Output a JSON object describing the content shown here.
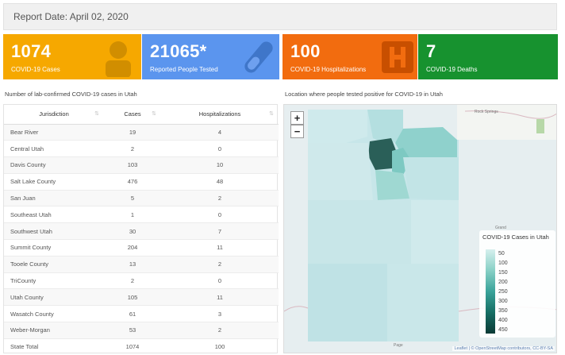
{
  "report_date": "Report Date: April 02, 2020",
  "cards": [
    {
      "value": "1074",
      "label": "COVID-19 Cases",
      "icon": "person-icon",
      "color": "#f6a800"
    },
    {
      "value": "21065*",
      "label": "Reported People Tested",
      "icon": "test-tube-icon",
      "color": "#5b95ee"
    },
    {
      "value": "100",
      "label": "COVID-19 Hospitalizations",
      "icon": "hospital-icon",
      "color": "#f26c0f"
    },
    {
      "value": "7",
      "label": "COVID-19 Deaths",
      "icon": "",
      "color": "#17922f"
    }
  ],
  "table": {
    "title": "Number of lab-confirmed COVID-19 cases in Utah",
    "headers": [
      "Jurisdiction",
      "Cases",
      "Hospitalizations"
    ],
    "rows": [
      [
        "Bear River",
        "19",
        "4"
      ],
      [
        "Central Utah",
        "2",
        "0"
      ],
      [
        "Davis County",
        "103",
        "10"
      ],
      [
        "Salt Lake County",
        "476",
        "48"
      ],
      [
        "San Juan",
        "5",
        "2"
      ],
      [
        "Southeast Utah",
        "1",
        "0"
      ],
      [
        "Southwest Utah",
        "30",
        "7"
      ],
      [
        "Summit County",
        "204",
        "11"
      ],
      [
        "Tooele County",
        "13",
        "2"
      ],
      [
        "TriCounty",
        "2",
        "0"
      ],
      [
        "Utah County",
        "105",
        "11"
      ],
      [
        "Wasatch County",
        "61",
        "3"
      ],
      [
        "Weber-Morgan",
        "53",
        "2"
      ],
      [
        "State Total",
        "1074",
        "100"
      ]
    ]
  },
  "map": {
    "title": "Location where people tested positive for COVID-19 in Utah",
    "zoom_in": "+",
    "zoom_out": "−",
    "legend_title": "COVID-19 Cases in Utah",
    "legend_ticks": [
      "50",
      "100",
      "150",
      "200",
      "250",
      "300",
      "350",
      "400",
      "450"
    ],
    "attribution": "Leaflet | © OpenStreetMap contributors, CC-BY-SA",
    "place_labels": [
      "Rock Springs",
      "Grand",
      "Page"
    ]
  }
}
